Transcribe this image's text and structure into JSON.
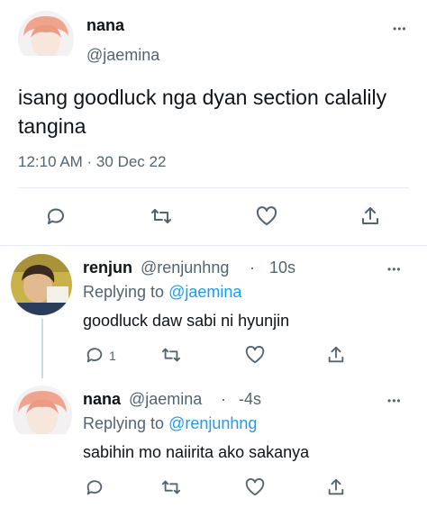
{
  "main_tweet": {
    "name": "nana",
    "handle": "@jaemina",
    "text": "isang goodluck nga dyan section calalily tangina",
    "timestamp": "12:10 AM · 30 Dec 22",
    "more": "•••"
  },
  "replies": [
    {
      "name": "renjun",
      "handle": "@renjunhng",
      "separator": "·",
      "time": "10s",
      "replying_prefix": "Replying to ",
      "replying_to": "@jaemina",
      "text": "goodluck daw sabi ni hyunjin",
      "reply_count": "1",
      "more": "•••"
    },
    {
      "name": "nana",
      "handle": "@jaemina",
      "separator": "·",
      "time": "-4s",
      "replying_prefix": "Replying to ",
      "replying_to": "@renjunhng",
      "text": "sabihin mo naiirita ako sakanya",
      "more": "•••"
    }
  ],
  "colors": {
    "link": "#1d9bf0",
    "secondary": "#536471",
    "divider": "#e6ecf0"
  },
  "icons": [
    "reply-icon",
    "retweet-icon",
    "like-icon",
    "share-icon",
    "more-icon"
  ]
}
